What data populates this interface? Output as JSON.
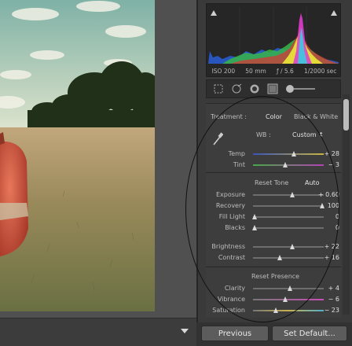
{
  "histogram": {
    "meta": {
      "iso": "ISO 200",
      "focal": "50 mm",
      "aperture": "ƒ / 5.6",
      "shutter": "1/2000 sec"
    }
  },
  "tools": [
    "crop-overlay-icon",
    "spot-removal-icon",
    "red-eye-icon",
    "graduated-filter-icon",
    "adjustment-brush-icon"
  ],
  "basic": {
    "treatment_label": "Treatment :",
    "treatment_color": "Color",
    "treatment_bw": "Black & White",
    "wb_label": "WB :",
    "wb_value": "Custom ↕",
    "temp": {
      "label": "Temp",
      "value": "+ 28",
      "position": 0.58
    },
    "tint": {
      "label": "Tint",
      "value": "− 3",
      "position": 0.46
    },
    "tone_reset": "Reset Tone",
    "tone_auto": "Auto",
    "exposure": {
      "label": "Exposure",
      "value": "+ 0.60",
      "position": 0.56
    },
    "recovery": {
      "label": "Recovery",
      "value": "100",
      "position": 0.98
    },
    "fill_light": {
      "label": "Fill Light",
      "value": "0",
      "position": 0.02
    },
    "blacks": {
      "label": "Blacks",
      "value": "0",
      "position": 0.02
    },
    "brightness": {
      "label": "Brightness",
      "value": "+ 22",
      "position": 0.55
    },
    "contrast": {
      "label": "Contrast",
      "value": "+ 16",
      "position": 0.38
    },
    "presence_reset": "Reset Presence",
    "clarity": {
      "label": "Clarity",
      "value": "+ 4",
      "position": 0.52
    },
    "vibrance": {
      "label": "Vibrance",
      "value": "− 6",
      "position": 0.45
    },
    "saturation": {
      "label": "Saturation",
      "value": "− 23",
      "position": 0.32
    }
  },
  "footer": {
    "previous": "Previous",
    "set_default": "Set Default..."
  },
  "colors": {
    "panel": "#3a3a3a",
    "histogram_bg": "#262626",
    "slider_thumb": "#d9d9d9"
  }
}
